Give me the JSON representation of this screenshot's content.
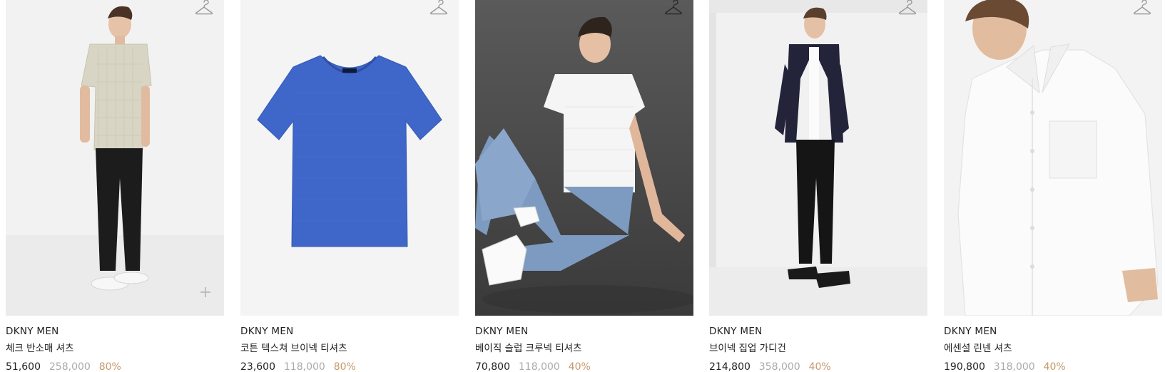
{
  "products": [
    {
      "brand": "DKNY MEN",
      "name": "체크 반소매 셔츠",
      "price": "51,600",
      "original_price": "258,000",
      "discount": "80%"
    },
    {
      "brand": "DKNY MEN",
      "name": "코튼 텍스쳐 브이넥 티셔츠",
      "price": "23,600",
      "original_price": "118,000",
      "discount": "80%"
    },
    {
      "brand": "DKNY MEN",
      "name": "베이직 슬럽 크루넥 티셔츠",
      "price": "70,800",
      "original_price": "118,000",
      "discount": "40%"
    },
    {
      "brand": "DKNY MEN",
      "name": "브이넥 집업 가디건",
      "price": "214,800",
      "original_price": "358,000",
      "discount": "40%"
    },
    {
      "brand": "DKNY MEN",
      "name": "에센셜 린넨 셔츠",
      "price": "190,800",
      "original_price": "318,000",
      "discount": "40%"
    }
  ],
  "icons": {
    "wishlist": "hanger-icon",
    "quick_add": "plus-icon"
  },
  "colors": {
    "discount": "#c49a6c",
    "original_price": "#aaaaaa",
    "text": "#222222"
  }
}
